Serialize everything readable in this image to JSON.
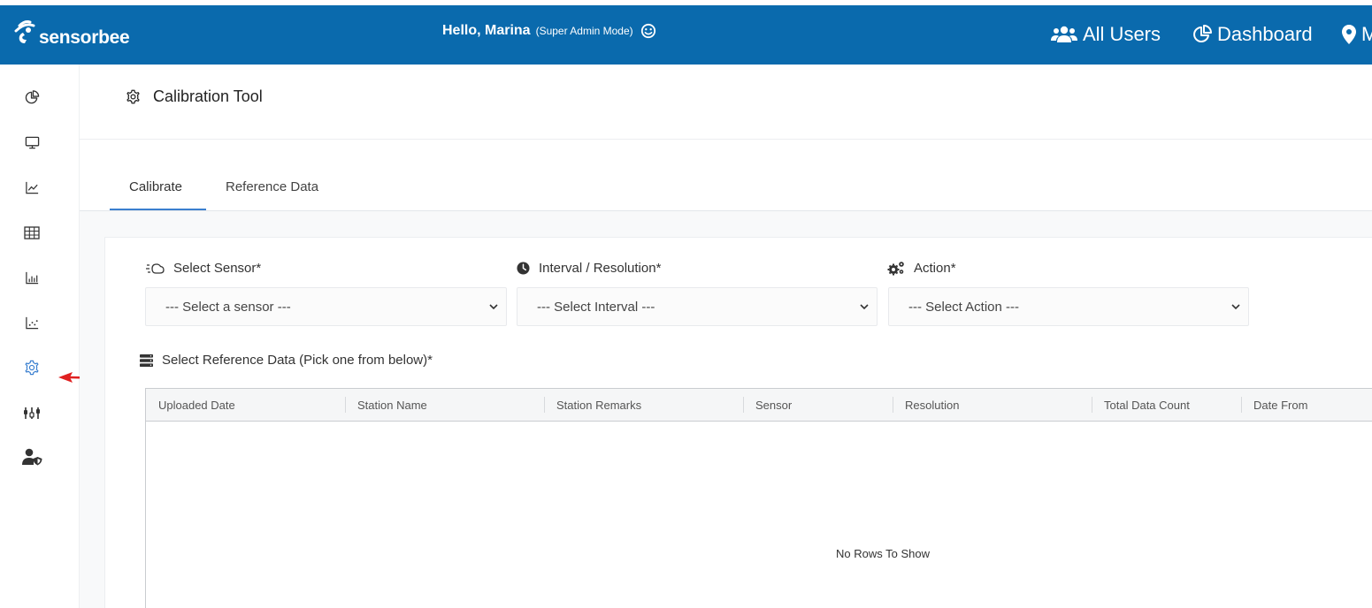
{
  "header": {
    "brand": "sensorbee",
    "greeting": "Hello, Marina",
    "mode": "(Super Admin Mode)",
    "nav": [
      {
        "label": "All Users",
        "icon": "users-icon"
      },
      {
        "label": "Dashboard",
        "icon": "pie-chart-icon"
      },
      {
        "label": "M",
        "icon": "map-marker-icon"
      }
    ],
    "colors": {
      "bar": "#0a6aad",
      "text": "#ffffff"
    }
  },
  "sidebar": {
    "items": [
      {
        "icon": "pie-chart-icon",
        "active": false
      },
      {
        "icon": "monitor-icon",
        "active": false
      },
      {
        "icon": "line-chart-icon",
        "active": false
      },
      {
        "icon": "table-icon",
        "active": false
      },
      {
        "icon": "bar-chart-icon",
        "active": false
      },
      {
        "icon": "scatter-chart-icon",
        "active": false
      },
      {
        "icon": "gear-icon",
        "active": true
      },
      {
        "icon": "sliders-icon",
        "active": false
      },
      {
        "icon": "user-shield-icon",
        "active": false
      }
    ],
    "active_color": "#3a7fcf"
  },
  "page": {
    "title": "Calibration Tool",
    "title_icon": "gear-icon"
  },
  "tabs": [
    {
      "label": "Calibrate",
      "active": true
    },
    {
      "label": "Reference Data",
      "active": false
    }
  ],
  "form": {
    "sensor": {
      "label": "Select Sensor*",
      "icon": "sensor-icon",
      "value": "--- Select a sensor ---"
    },
    "interval": {
      "label": "Interval / Resolution*",
      "icon": "clock-icon",
      "value": "--- Select Interval ---"
    },
    "action": {
      "label": "Action*",
      "icon": "gears-icon",
      "value": "--- Select Action ---"
    },
    "reference": {
      "label": "Select Reference Data (Pick one from below)*",
      "icon": "database-icon"
    }
  },
  "table": {
    "columns": [
      "Uploaded Date",
      "Station Name",
      "Station Remarks",
      "Sensor",
      "Resolution",
      "Total Data Count",
      "Date From"
    ],
    "empty_text": "No Rows To Show"
  },
  "annotation": {
    "arrow_color": "#e02020"
  }
}
